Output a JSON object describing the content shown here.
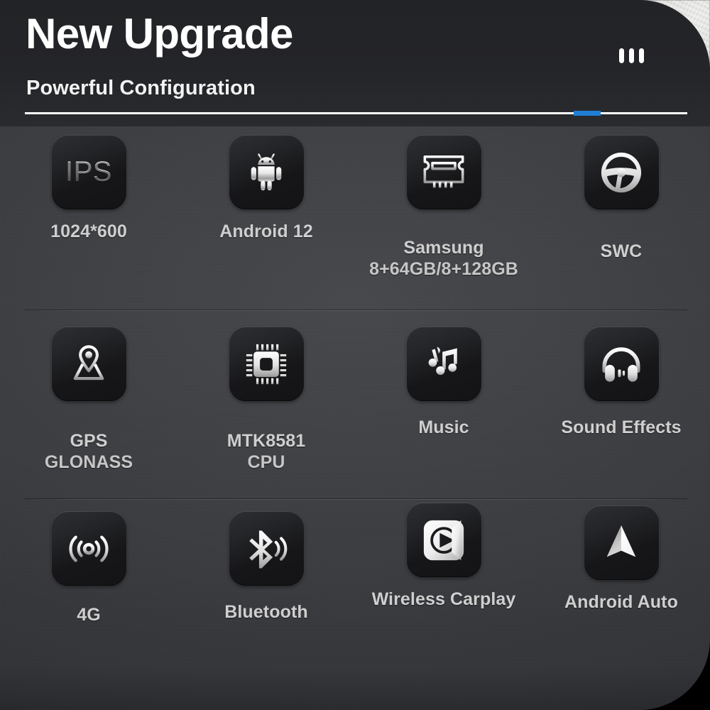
{
  "header": {
    "title": "New Upgrade",
    "subtitle": "Powerful Configuration",
    "menu_icon": "three-vertical-bars-icon",
    "accent_color": "#1e7fd4",
    "rule_color": "#ffffff"
  },
  "features": {
    "rows": [
      {
        "cells": [
          {
            "icon": "ips-display-icon",
            "icon_text": "IPS",
            "label": "1024*600",
            "sublabel": ""
          },
          {
            "icon": "android-robot-icon",
            "icon_text": "",
            "label": "Android 12",
            "sublabel": ""
          },
          {
            "icon": "ram-module-icon",
            "icon_text": "",
            "label": "Samsung",
            "sublabel": "8+64GB/8+128GB"
          },
          {
            "icon": "steering-wheel-icon",
            "icon_text": "",
            "label": "SWC",
            "sublabel": ""
          }
        ]
      },
      {
        "cells": [
          {
            "icon": "map-pin-icon",
            "icon_text": "",
            "label": "GPS",
            "sublabel": "GLONASS"
          },
          {
            "icon": "cpu-chip-icon",
            "icon_text": "",
            "label": "MTK8581",
            "sublabel": "CPU"
          },
          {
            "icon": "music-note-icon",
            "icon_text": "",
            "label": "Music",
            "sublabel": ""
          },
          {
            "icon": "headphones-icon",
            "icon_text": "",
            "label": "Sound Effects",
            "sublabel": ""
          }
        ]
      },
      {
        "cells": [
          {
            "icon": "signal-waves-icon",
            "icon_text": "",
            "label": "4G",
            "sublabel": ""
          },
          {
            "icon": "bluetooth-icon",
            "icon_text": "",
            "label": "Bluetooth",
            "sublabel": ""
          },
          {
            "icon": "carplay-icon",
            "icon_text": "",
            "label": "Wireless Carplay",
            "sublabel": ""
          },
          {
            "icon": "android-auto-icon",
            "icon_text": "",
            "label": "Android Auto",
            "sublabel": ""
          }
        ]
      }
    ]
  }
}
